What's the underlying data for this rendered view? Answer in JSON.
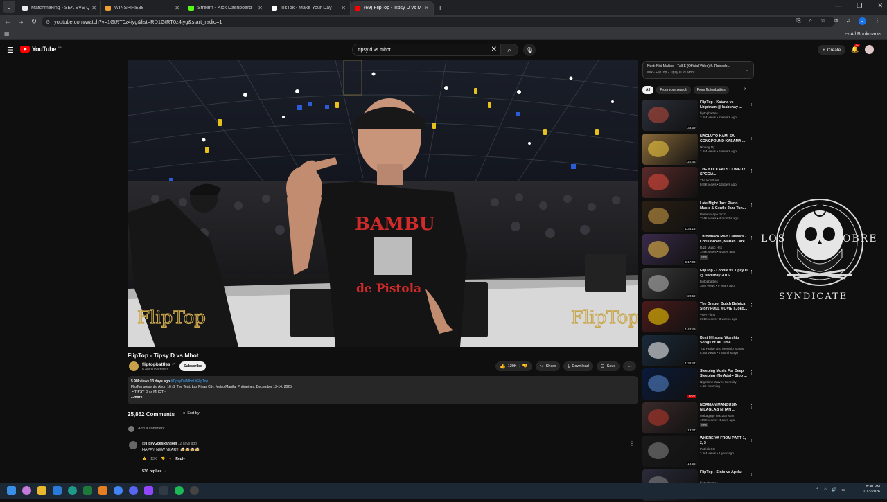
{
  "browser": {
    "tabs": [
      {
        "title": "Matchmaking - SEA SVS Queue",
        "color": "#e8eaed"
      },
      {
        "title": "WINSPIRE88",
        "color": "#f0a030"
      },
      {
        "title": "Stream - Kick Dashboard",
        "color": "#53fc18"
      },
      {
        "title": "TikTok - Make Your Day",
        "color": "#ffffff"
      },
      {
        "title": "(69) FlipTop - Tipsy D vs M",
        "color": "#ff0000"
      }
    ],
    "url": "youtube.com/watch?v=1GtRT0z4iyg&list=RD1GtRT0z4iyg&start_radio=1",
    "all_bookmarks": "All Bookmarks"
  },
  "header": {
    "logo": "YouTube",
    "logo_sup": "PH",
    "search_value": "tipsy d vs mhot",
    "create": "Create",
    "notif_count": "9+"
  },
  "video": {
    "title": "FlipTop - Tipsy D vs Mhot",
    "channel": "fliptopbattles",
    "subs": "8.4M subscribers",
    "subscribe": "Subscribe",
    "likes": "129K",
    "share": "Share",
    "download": "Download",
    "save": "Save",
    "watermark_left": "FlipTop",
    "watermark_right": "FlipTop",
    "shirt_text": "BAMBU",
    "shirt_text2": "de Pistola"
  },
  "description": {
    "stats": "5.9M views  13 days ago",
    "tags": "#TipsyD #Mhot #FlipTop",
    "line1": "FlipTop presents: Ahon 16 @ The Tent, Las Pinas City, Metro Manila, Philippines. December 13-14, 2025.",
    "line2": "•  TIPSY D vs MHOT -",
    "more": "...more"
  },
  "comments": {
    "count": "25,862 Comments",
    "sort": "Sort by",
    "add": "Add a comment...",
    "first": {
      "handle": "@TipsyGoesRandom",
      "time": "12 days ago",
      "text": "HAPPY NEW YEAR!!! 🍻🍻🍻🍻",
      "likes": "13K",
      "reply": "Reply",
      "replies": "530 replies"
    }
  },
  "sidebar": {
    "next_title": "Next: Niki Makino - TABE (Official Video) ft. Robledo...",
    "next_sub": "Mix - FlipTop - Tipsy D vs Mhot",
    "chips": [
      "All",
      "From your search",
      "From fliptopbattles"
    ],
    "recs": [
      {
        "title": "FlipTop - Katana vs Lhipkram @ Isabuhay ...",
        "channel": "fliptopbattles",
        "meta": "2.5M views • 2 weeks ago",
        "dur": "33:59",
        "thumb": "#2b2f3a",
        "accent": "#c24a3a"
      },
      {
        "title": "NAGLUTO KAMI SA CONGPOUND KASAMA ...",
        "channel": "Ninong Ry",
        "meta": "2.1M views • 5 weeks ago",
        "dur": "20:46",
        "thumb": "#8a6a3a",
        "accent": "#f4d03f"
      },
      {
        "title": "THE KOOLPALS COMEDY SPECIAL",
        "channel": "The KoolPals",
        "meta": "849K views • 13 days ago",
        "dur": "",
        "thumb": "#5a2a2a",
        "accent": "#e74c3c"
      },
      {
        "title": "Late Night Jazz Piano Music & Gentle Jazz Tun...",
        "channel": "Dreamscape Jazz",
        "meta": "724K views • 4 months ago",
        "dur": "1:36:13",
        "thumb": "#2a1f14",
        "accent": "#d4a24a"
      },
      {
        "title": "Throwback R&B Classics - Chris Brown, Mariah Care...",
        "channel": "R&B Music Hits",
        "meta": "144K views • 4 days ago",
        "dur": "6:17:00",
        "thumb": "#3a2a4a",
        "accent": "#f5c542",
        "new": "New"
      },
      {
        "title": "FlipTop - Loonie vs Tipsy D @ Isabuhay 2016 ...",
        "channel": "fliptopbattles",
        "meta": "38M views • 9 years ago",
        "dur": "20:59",
        "thumb": "#3a3a3a",
        "accent": "#bbbbbb"
      },
      {
        "title": "The Gregor Butch Belgica Story FULL MOVIE | Joko...",
        "channel": "VIVA Films",
        "meta": "271K views • 3 weeks ago",
        "dur": "1:48:49",
        "thumb": "#4a1a1a",
        "accent": "#ffd700"
      },
      {
        "title": "Best Hillsong Worship Songs of All Time | ...",
        "channel": "Top Praise and Worship Songs",
        "meta": "8.8M views • 7 months ago",
        "dur": "1:38:47",
        "thumb": "#1a2a3a",
        "accent": "#ffffff"
      },
      {
        "title": "Sleeping Music For Deep Sleeping (No Ads) • Stop ...",
        "channel": "Nighttime Waves Serenity",
        "meta": "1.6K watching",
        "dur": "LIVE",
        "thumb": "#0a1a3a",
        "accent": "#5a8ad4"
      },
      {
        "title": "NORMAN MANGUSIN NILAGLAG NI IAN ...",
        "channel": "Makagago Wazzup Man",
        "meta": "459K views • 4 days ago",
        "dur": "13:27",
        "thumb": "#3a2a2a",
        "accent": "#c0392b",
        "new": "New"
      },
      {
        "title": "WHERE YA FROM PART 1, 2, 3",
        "channel": "Patrick SG",
        "meta": "2.5M views • 1 year ago",
        "dur": "19:55",
        "thumb": "#1a1a1a",
        "accent": "#888888"
      },
      {
        "title": "FlipTop - Sinio vs Apekz",
        "channel": "fliptopbattles",
        "meta": "",
        "dur": "",
        "thumb": "#2a2a3a",
        "accent": "#888888"
      }
    ]
  },
  "emblem": {
    "left": "LOS",
    "right": "OBRE",
    "bottom": "SYNDICATE"
  },
  "taskbar": {
    "time": "8:30 PM",
    "date": "1/13/2026"
  }
}
